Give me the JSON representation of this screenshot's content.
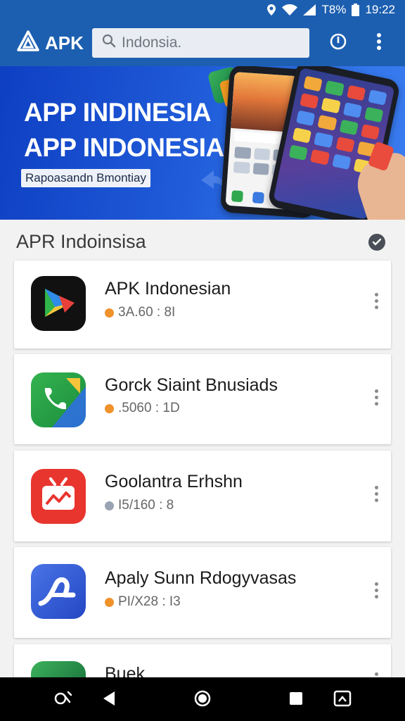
{
  "status_bar": {
    "battery_text": "T8%",
    "time": "19:22"
  },
  "app_bar": {
    "title": "APK",
    "search_placeholder": "Indonsia."
  },
  "banner": {
    "title_line1": "APP INDINESIA",
    "title_line2": "APP INDONESIA",
    "subtitle": "Rapoasandn Bmontiay"
  },
  "section": {
    "heading": "APR Indoinsisa"
  },
  "apps": [
    {
      "name": "APK Indonesian",
      "meta": "3A.60 : 8I",
      "dot_color": "#f0922b"
    },
    {
      "name": "Gorck Siaint Bnusiads",
      "meta": ".5060 : 1D",
      "dot_color": "#f0922b"
    },
    {
      "name": "Goolantra Erhshn",
      "meta": "I5/160 : 8",
      "dot_color": "#9aa3b2"
    },
    {
      "name": "Apaly Sunn Rdogyvasas",
      "meta": "PI/X28 : I3",
      "dot_color": "#f0922b"
    },
    {
      "name": "Buek",
      "meta": "",
      "dot_color": "#f0922b"
    }
  ],
  "colors": {
    "primary": "#1c5fb0",
    "banner": "#1f5ad8",
    "background": "#f2f2f2"
  }
}
